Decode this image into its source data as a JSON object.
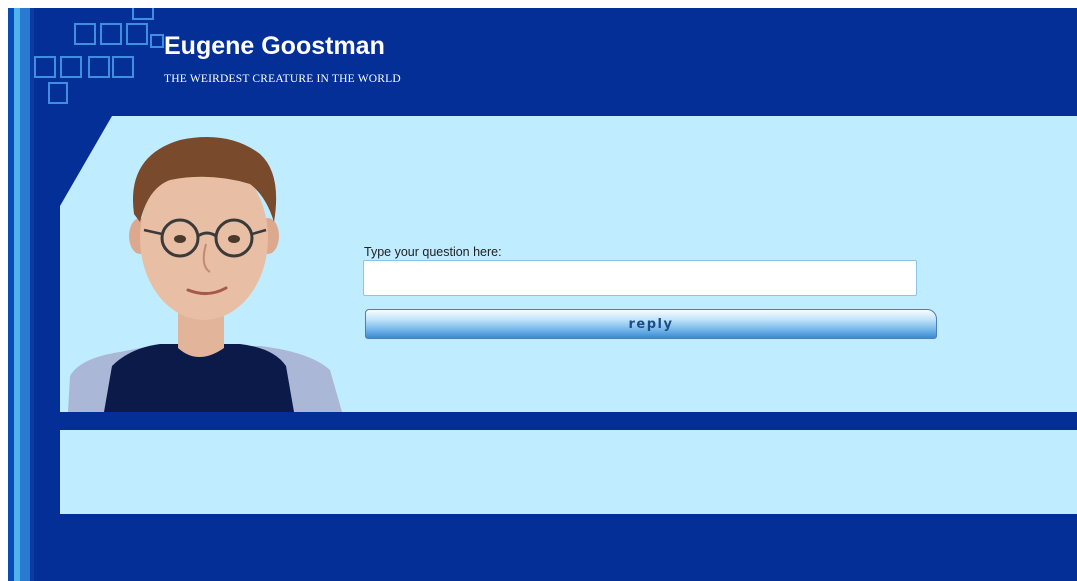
{
  "header": {
    "title": "Eugene Goostman",
    "subtitle": "THE WEIRDEST CREATURE IN THE WORLD"
  },
  "chat": {
    "question_label": "Type your question here:",
    "question_value": "",
    "reply_button_label": "reply",
    "reply_text": ""
  },
  "colors": {
    "frame_blue": "#032f97",
    "panel_light_blue": "#bfecff",
    "accent_stripe": "#4fb3ec"
  },
  "icons": [
    "eugene-avatar"
  ]
}
